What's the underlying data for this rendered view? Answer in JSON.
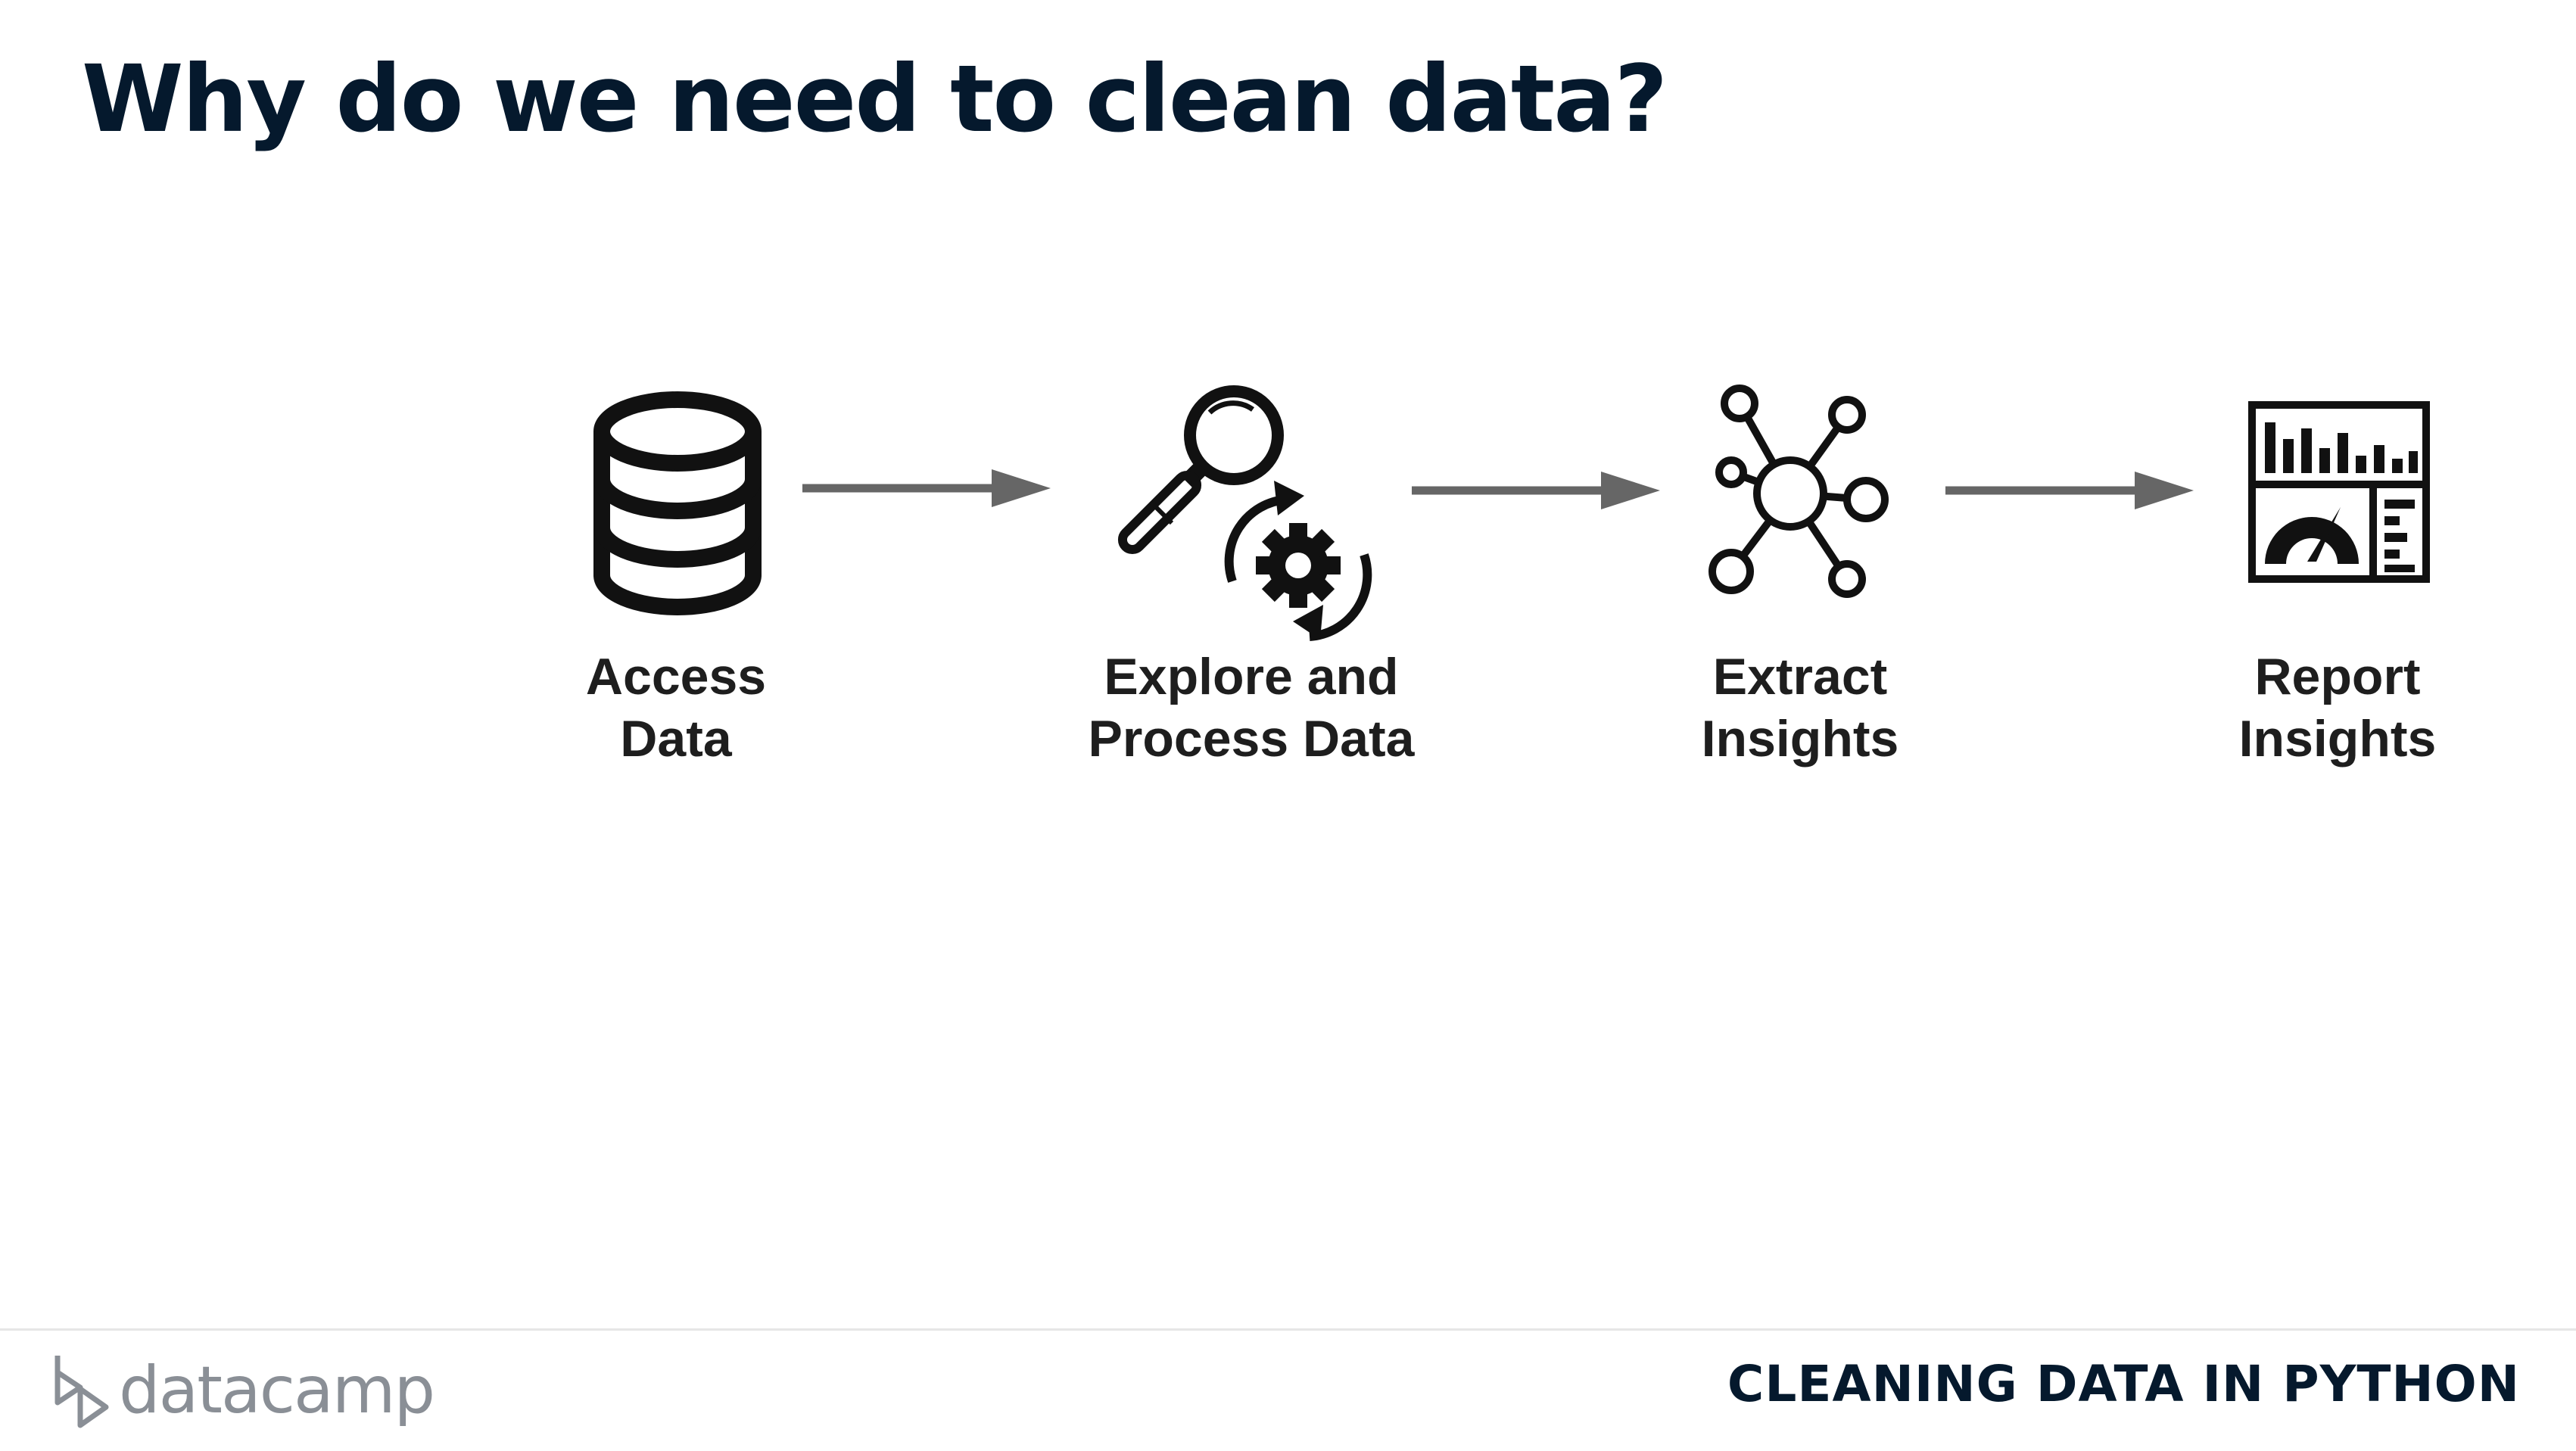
{
  "slide": {
    "title": "Why do we need to clean data?"
  },
  "pipeline": {
    "steps": [
      {
        "line1": "Access",
        "line2": "Data",
        "icon": "database-icon"
      },
      {
        "line1": "Explore and",
        "line2": "Process Data",
        "icon": "magnifier-gear-icon"
      },
      {
        "line1": "Extract",
        "line2": "Insights",
        "icon": "network-icon"
      },
      {
        "line1": "Report",
        "line2": "Insights",
        "icon": "dashboard-icon"
      }
    ],
    "arrow_color": "#666666",
    "icon_color": "#111111"
  },
  "footer": {
    "brand": "datacamp",
    "course": "CLEANING DATA IN PYTHON"
  }
}
